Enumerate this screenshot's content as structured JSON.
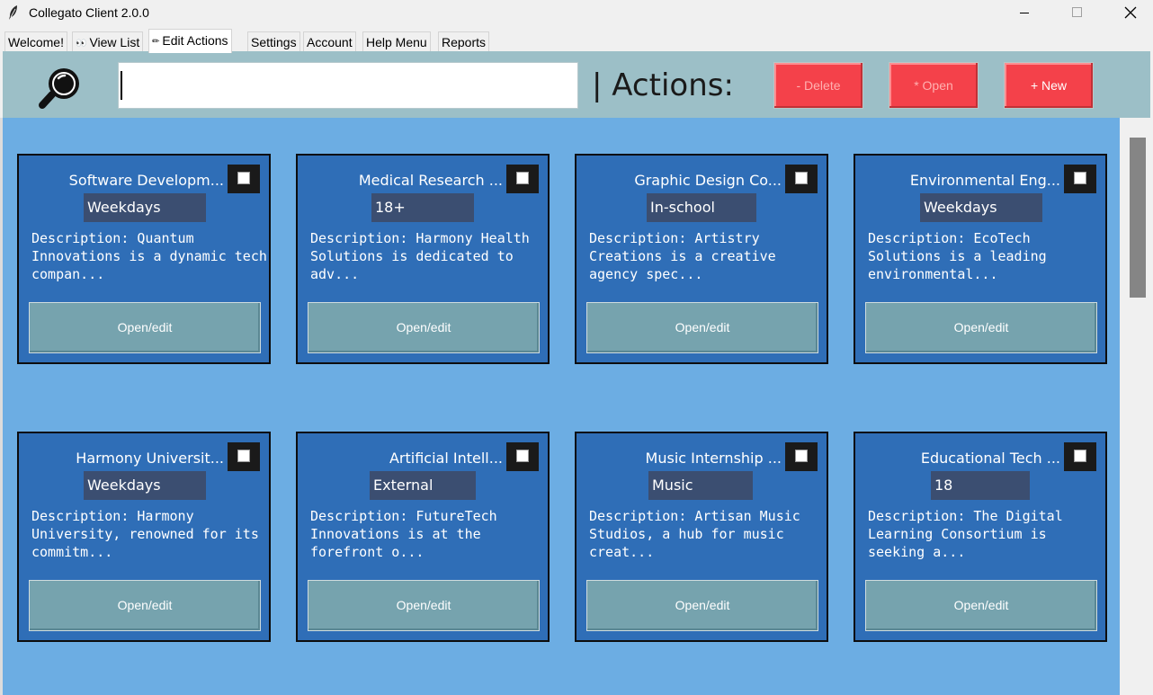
{
  "window": {
    "title": "Collegato Client 2.0.0",
    "controls": [
      "minimize-icon",
      "maximize-icon",
      "close-icon"
    ]
  },
  "tabs": [
    {
      "label": "Welcome!",
      "icon": null,
      "active": false
    },
    {
      "label": "View List",
      "icon": "eyes-icon",
      "active": false
    },
    {
      "label": "Edit Actions",
      "icon": "pencil-icon",
      "active": true
    },
    {
      "label": "Settings",
      "icon": null,
      "active": false
    },
    {
      "label": "Account",
      "icon": null,
      "active": false
    },
    {
      "label": "Help Menu",
      "icon": null,
      "active": false
    },
    {
      "label": "Reports",
      "icon": null,
      "active": false
    }
  ],
  "toolbar": {
    "search_icon": "magnifier-icon",
    "search_value": "",
    "actions_label": "| Actions:",
    "delete_label": "- Delete",
    "open_label": "* Open",
    "new_label": "+ New"
  },
  "cards": [
    {
      "title": "Software Developm...",
      "tag": "Weekdays",
      "description": "Description: Quantum Innovations is a dynamic tech compan...",
      "checked": false,
      "button": "Open/edit"
    },
    {
      "title": "Medical Research ...",
      "tag": "18+",
      "description": "Description: Harmony Health Solutions is dedicated to adv...",
      "checked": false,
      "button": "Open/edit"
    },
    {
      "title": "Graphic Design Co...",
      "tag": "In-school",
      "description": "Description: Artistry Creations is a creative agency spec...",
      "checked": false,
      "button": "Open/edit"
    },
    {
      "title": "Environmental Eng...",
      "tag": "Weekdays",
      "description": "Description: EcoTech Solutions is a leading environmental...",
      "checked": false,
      "button": "Open/edit"
    },
    {
      "title": "Harmony Universit...",
      "tag": "Weekdays",
      "description": "Description: Harmony University, renowned for its commitm...",
      "checked": false,
      "button": "Open/edit"
    },
    {
      "title": "Artificial Intell...",
      "tag": "External",
      "description": "Description: FutureTech Innovations is at the forefront o...",
      "checked": false,
      "button": "Open/edit"
    },
    {
      "title": "Music Internship ...",
      "tag": "Music",
      "description": "Description: Artisan Music Studios, a hub for music creat...",
      "checked": false,
      "button": "Open/edit"
    },
    {
      "title": "Educational Tech ...",
      "tag": "18",
      "description": "Description: The Digital Learning Consortium is seeking a...",
      "checked": false,
      "button": "Open/edit"
    }
  ],
  "colors": {
    "toolbar_bg": "#9cbfc7",
    "canvas_bg": "#6cade3",
    "card_bg": "#2f6eb7",
    "tag_bg": "#3b4e71",
    "card_button_bg": "#76a3ae",
    "action_button_bg": "#f4414a"
  }
}
